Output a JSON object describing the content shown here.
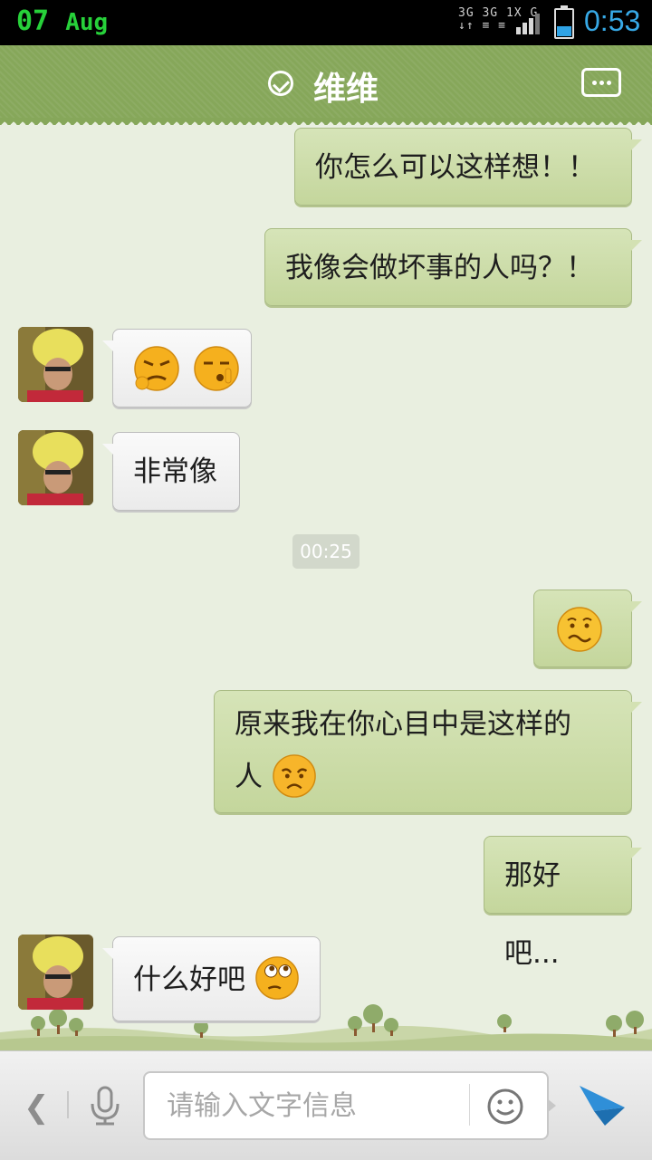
{
  "status_bar": {
    "day": "07",
    "month": "Aug",
    "network_line1": "3G 3G 1X G",
    "network_line2": "↓↑ ≡ ≡",
    "time": "0:53",
    "battery_color": "#2fa3e6"
  },
  "header": {
    "title": "维维",
    "verified_icon": "check-circle-icon",
    "more_icon": "chat-more-icon",
    "bar_color": "#86a75a"
  },
  "messages": [
    {
      "side": "me",
      "text": "你怎么可以这样想！！"
    },
    {
      "side": "me",
      "text": "我像会做坏事的人吗？！"
    },
    {
      "side": "them",
      "emojis": [
        "grumpy-emoji",
        "shush-emoji"
      ]
    },
    {
      "side": "them",
      "text": "非常像"
    },
    {
      "side": "me",
      "emojis": [
        "worried-emoji"
      ]
    },
    {
      "side": "me",
      "text_line1": "原来我在你心目中是这样的",
      "text_line2": "人"
    },
    {
      "side": "me",
      "text": "那好吧..."
    },
    {
      "side": "them",
      "text": "什么好吧"
    }
  ],
  "timestamp": "00:25",
  "input_bar": {
    "placeholder": "请输入文字信息",
    "back_icon": "chevron-left-icon",
    "mic_icon": "microphone-icon",
    "emoji_icon": "smiley-icon",
    "send_icon": "send-arrow-icon"
  }
}
